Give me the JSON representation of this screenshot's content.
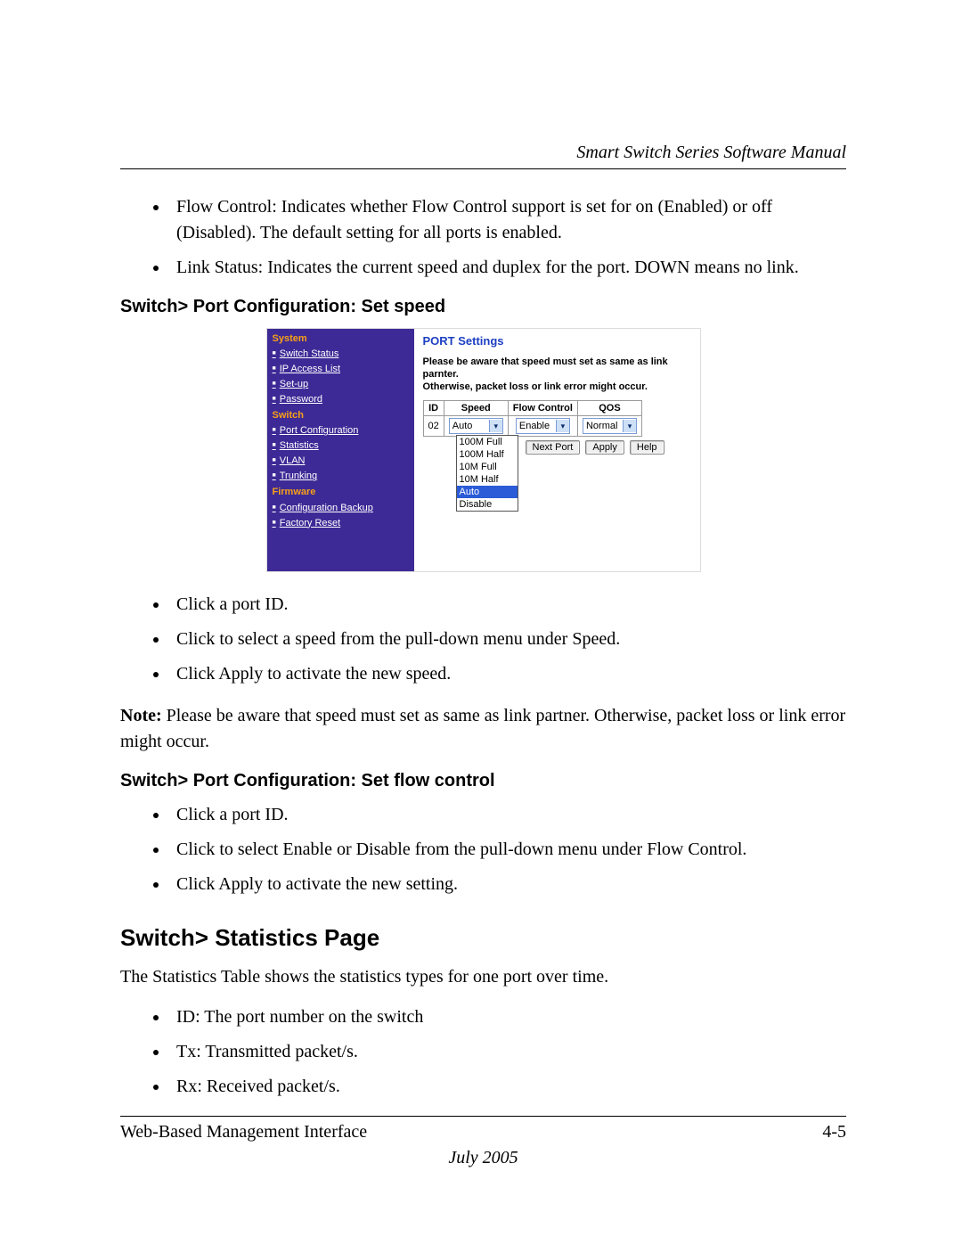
{
  "header": {
    "title": "Smart Switch Series Software Manual"
  },
  "bullets_top": [
    "Flow Control: Indicates whether Flow Control support is set for on (Enabled) or off (Disabled). The default setting for all ports is enabled.",
    "Link Status: Indicates the current speed and duplex for the port. DOWN means no link."
  ],
  "section1": {
    "title": "Switch> Port Configuration: Set speed",
    "bullets": [
      "Click a port ID.",
      "Click to select a speed from the pull-down menu under Speed.",
      "Click Apply to activate the new speed."
    ],
    "note_label": "Note:",
    "note_body": " Please be aware that speed must set as same as link partner. Otherwise, packet loss or link error might occur."
  },
  "section2": {
    "title": "Switch> Port Configuration: Set flow control",
    "bullets": [
      "Click a port ID.",
      "Click to select Enable or Disable from the pull-down menu under Flow Control.",
      "Click Apply to activate the new setting."
    ]
  },
  "section3": {
    "title": "Switch> Statistics Page",
    "intro": "The Statistics Table shows the statistics types for one port over time.",
    "bullets": [
      "ID: The port number on the switch",
      "Tx: Transmitted packet/s.",
      "Rx: Received packet/s."
    ]
  },
  "footer": {
    "left": "Web-Based Management Interface",
    "right": "4-5",
    "date": "July 2005"
  },
  "screenshot": {
    "sidebar": {
      "group_system": "System",
      "items_system": [
        "Switch Status",
        "IP Access List",
        "Set-up",
        "Password"
      ],
      "group_switch": "Switch",
      "items_switch": [
        "Port Configuration",
        "Statistics",
        "VLAN",
        "Trunking"
      ],
      "group_firmware": "Firmware",
      "items_firmware": [
        "Configuration Backup",
        "Factory Reset"
      ]
    },
    "main": {
      "title": "PORT Settings",
      "warn1": "Please be aware that speed must set as same as link parnter.",
      "warn2": "Otherwise, packet loss or link error might occur.",
      "cols": {
        "id": "ID",
        "speed": "Speed",
        "flow": "Flow Control",
        "qos": "QOS"
      },
      "row": {
        "id": "02",
        "speed": "Auto",
        "flow": "Enable",
        "qos": "Normal"
      },
      "dropdown": [
        "100M Full",
        "100M Half",
        "10M Full",
        "10M Half",
        "Auto",
        "Disable"
      ],
      "dropdown_selected": "Auto",
      "buttons": {
        "next": "Next Port",
        "apply": "Apply",
        "help": "Help"
      }
    }
  }
}
